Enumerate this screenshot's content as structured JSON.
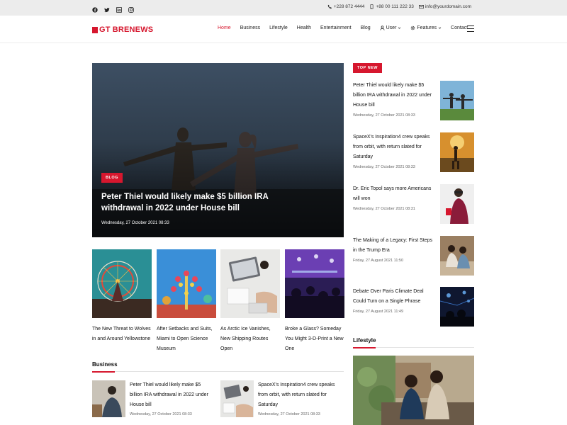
{
  "topbar": {
    "social": [
      "facebook-icon",
      "twitter-icon",
      "linkedin-icon",
      "instagram-icon"
    ],
    "phone1": "+228 872 4444",
    "phone2": "+88 00 111 222 33",
    "email": "info@yourdomain.com"
  },
  "header": {
    "logo_prefix": "GT",
    "logo_brand": "BRENEWS",
    "nav": [
      {
        "label": "Home",
        "active": true
      },
      {
        "label": "Business"
      },
      {
        "label": "Lifestyle"
      },
      {
        "label": "Health"
      },
      {
        "label": "Entertainment"
      },
      {
        "label": "Blog"
      },
      {
        "label": "User",
        "icon": "user-icon",
        "dropdown": true
      },
      {
        "label": "Features",
        "icon": "gear-icon",
        "dropdown": true
      },
      {
        "label": "Contact"
      }
    ]
  },
  "hero": {
    "badge": "BLOG",
    "title": "Peter Thiel would likely make $5 billion IRA withdrawal in 2022 under House bill",
    "date": "Wednesday, 27 October 2021 08:33"
  },
  "cards": [
    {
      "title": "The New Threat to Wolves in and Around Yellowstone"
    },
    {
      "title": "After Setbacks and Suits, Miami to Open Science Museum"
    },
    {
      "title": "As Arctic Ice Vanishes, New Shipping Routes Open"
    },
    {
      "title": "Broke a Glass? Someday You Might 3-D-Print a New One"
    }
  ],
  "business": {
    "heading": "Business",
    "items": [
      {
        "title": "Peter Thiel would likely make $5 billion IRA withdrawal in 2022 under House bill",
        "date": "Wednesday, 27 October 2021 08:33"
      },
      {
        "title": "SpaceX's Inspiration4 crew speaks from orbit, with return slated for Saturday",
        "date": "Wednesday, 27 October 2021 08:33"
      }
    ]
  },
  "sidebar": {
    "badge": "TOP NEW",
    "items": [
      {
        "title": "Peter Thiel would likely make $5 billion IRA withdrawal in 2022 under House bill",
        "date": "Wednesday, 27 October 2021 08:33"
      },
      {
        "title": "SpaceX's Inspiration4 crew speaks from orbit, with return slated for Saturday",
        "date": "Wednesday, 27 October 2021 08:33"
      },
      {
        "title": "Dr. Eric Topol says more Americans will won",
        "date": "Wednesday, 27 October 2021 08:31"
      },
      {
        "title": "The Making of a Legacy: First Steps in the Trump Era",
        "date": "Friday, 27 August 2021 11:50"
      },
      {
        "title": "Debate Over Paris Climate Deal Could Turn on a Single Phrase",
        "date": "Friday, 27 August 2021 11:49"
      }
    ],
    "lifestyle_heading": "Lifestyle"
  },
  "colors": {
    "accent": "#d6172e",
    "topbar_bg": "#ececec"
  }
}
